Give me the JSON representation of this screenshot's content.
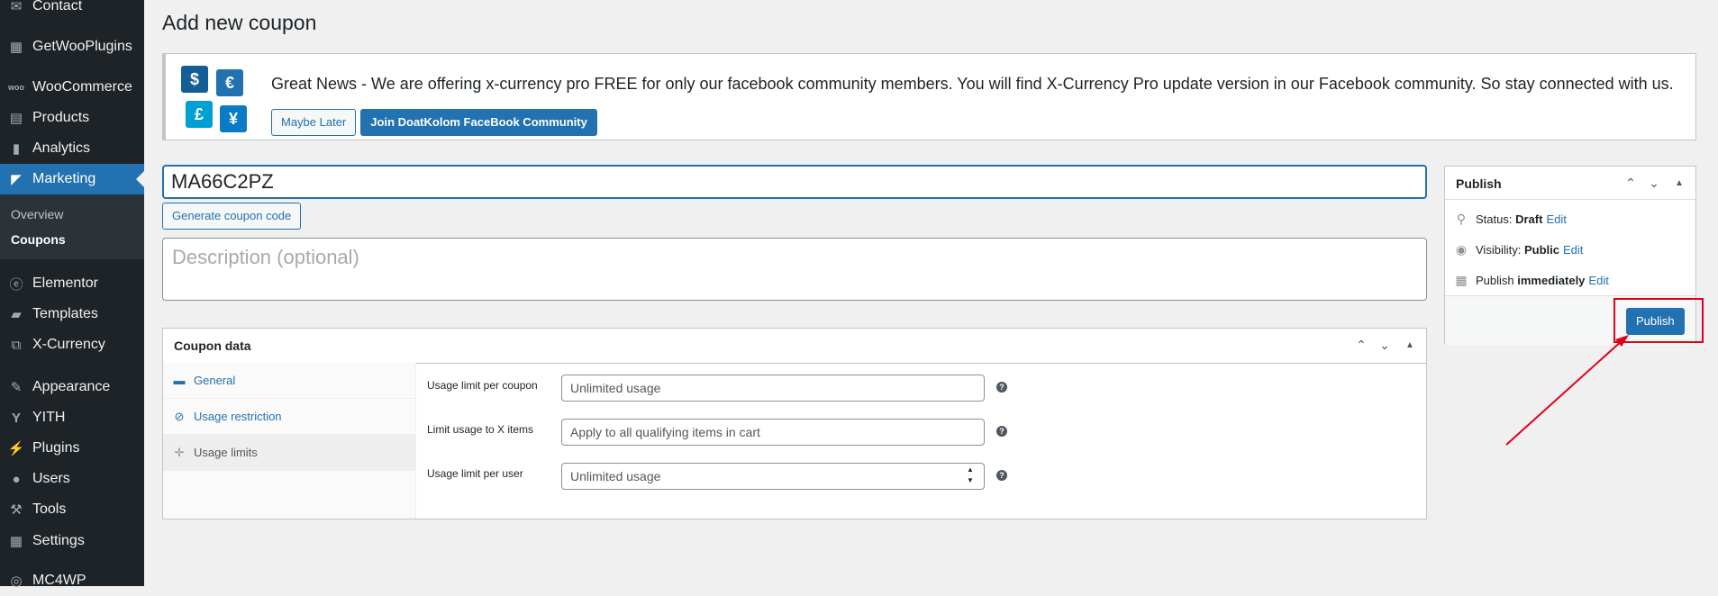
{
  "sidebar": {
    "items": [
      {
        "label": "Contact",
        "icon": "mail-icon"
      },
      {
        "label": "GetWooPlugins",
        "icon": "plugin-grid-icon"
      },
      {
        "label": "WooCommerce",
        "icon": "woo-icon"
      },
      {
        "label": "Products",
        "icon": "box-icon"
      },
      {
        "label": "Analytics",
        "icon": "bar-chart-icon"
      },
      {
        "label": "Marketing",
        "icon": "megaphone-icon"
      },
      {
        "label": "Elementor",
        "icon": "elementor-icon"
      },
      {
        "label": "Templates",
        "icon": "folder-icon"
      },
      {
        "label": "X-Currency",
        "icon": "currency-icon"
      },
      {
        "label": "Appearance",
        "icon": "paintbrush-icon"
      },
      {
        "label": "YITH",
        "icon": "yith-icon"
      },
      {
        "label": "Plugins",
        "icon": "plug-icon"
      },
      {
        "label": "Users",
        "icon": "user-icon"
      },
      {
        "label": "Tools",
        "icon": "wrench-icon"
      },
      {
        "label": "Settings",
        "icon": "settings-icon"
      },
      {
        "label": "MC4WP",
        "icon": "mc4wp-icon"
      }
    ],
    "submenu": [
      {
        "label": "Overview"
      },
      {
        "label": "Coupons"
      }
    ]
  },
  "page": {
    "title": "Add new coupon"
  },
  "notice": {
    "text": "Great News - We are offering x-currency pro FREE for only our facebook community members. You will find X-Currency Pro update version in our Facebook community. So stay connected with us.",
    "maybe_later": "Maybe Later",
    "join": "Join DoatKolom FaceBook Community",
    "currency_symbols": [
      "$",
      "€",
      "£",
      "¥"
    ],
    "accent_color": "#2271b1"
  },
  "coupon": {
    "code": "MA66C2PZ",
    "generate_label": "Generate coupon code",
    "description_placeholder": "Description (optional)"
  },
  "coupon_data": {
    "title": "Coupon data",
    "tabs": [
      {
        "label": "General",
        "icon": "ticket-icon"
      },
      {
        "label": "Usage restriction",
        "icon": "restriction-icon"
      },
      {
        "label": "Usage limits",
        "icon": "limits-icon"
      }
    ],
    "fields": [
      {
        "label": "Usage limit per coupon",
        "placeholder": "Unlimited usage"
      },
      {
        "label": "Limit usage to X items",
        "placeholder": "Apply to all qualifying items in cart"
      },
      {
        "label": "Usage limit per user",
        "placeholder": "Unlimited usage"
      }
    ]
  },
  "publish": {
    "title": "Publish",
    "status_label": "Status:",
    "status_value": "Draft",
    "visibility_label": "Visibility:",
    "visibility_value": "Public",
    "publish_label": "Publish",
    "publish_value": "immediately",
    "edit": "Edit",
    "button": "Publish",
    "highlight_color": "#e1001a"
  }
}
